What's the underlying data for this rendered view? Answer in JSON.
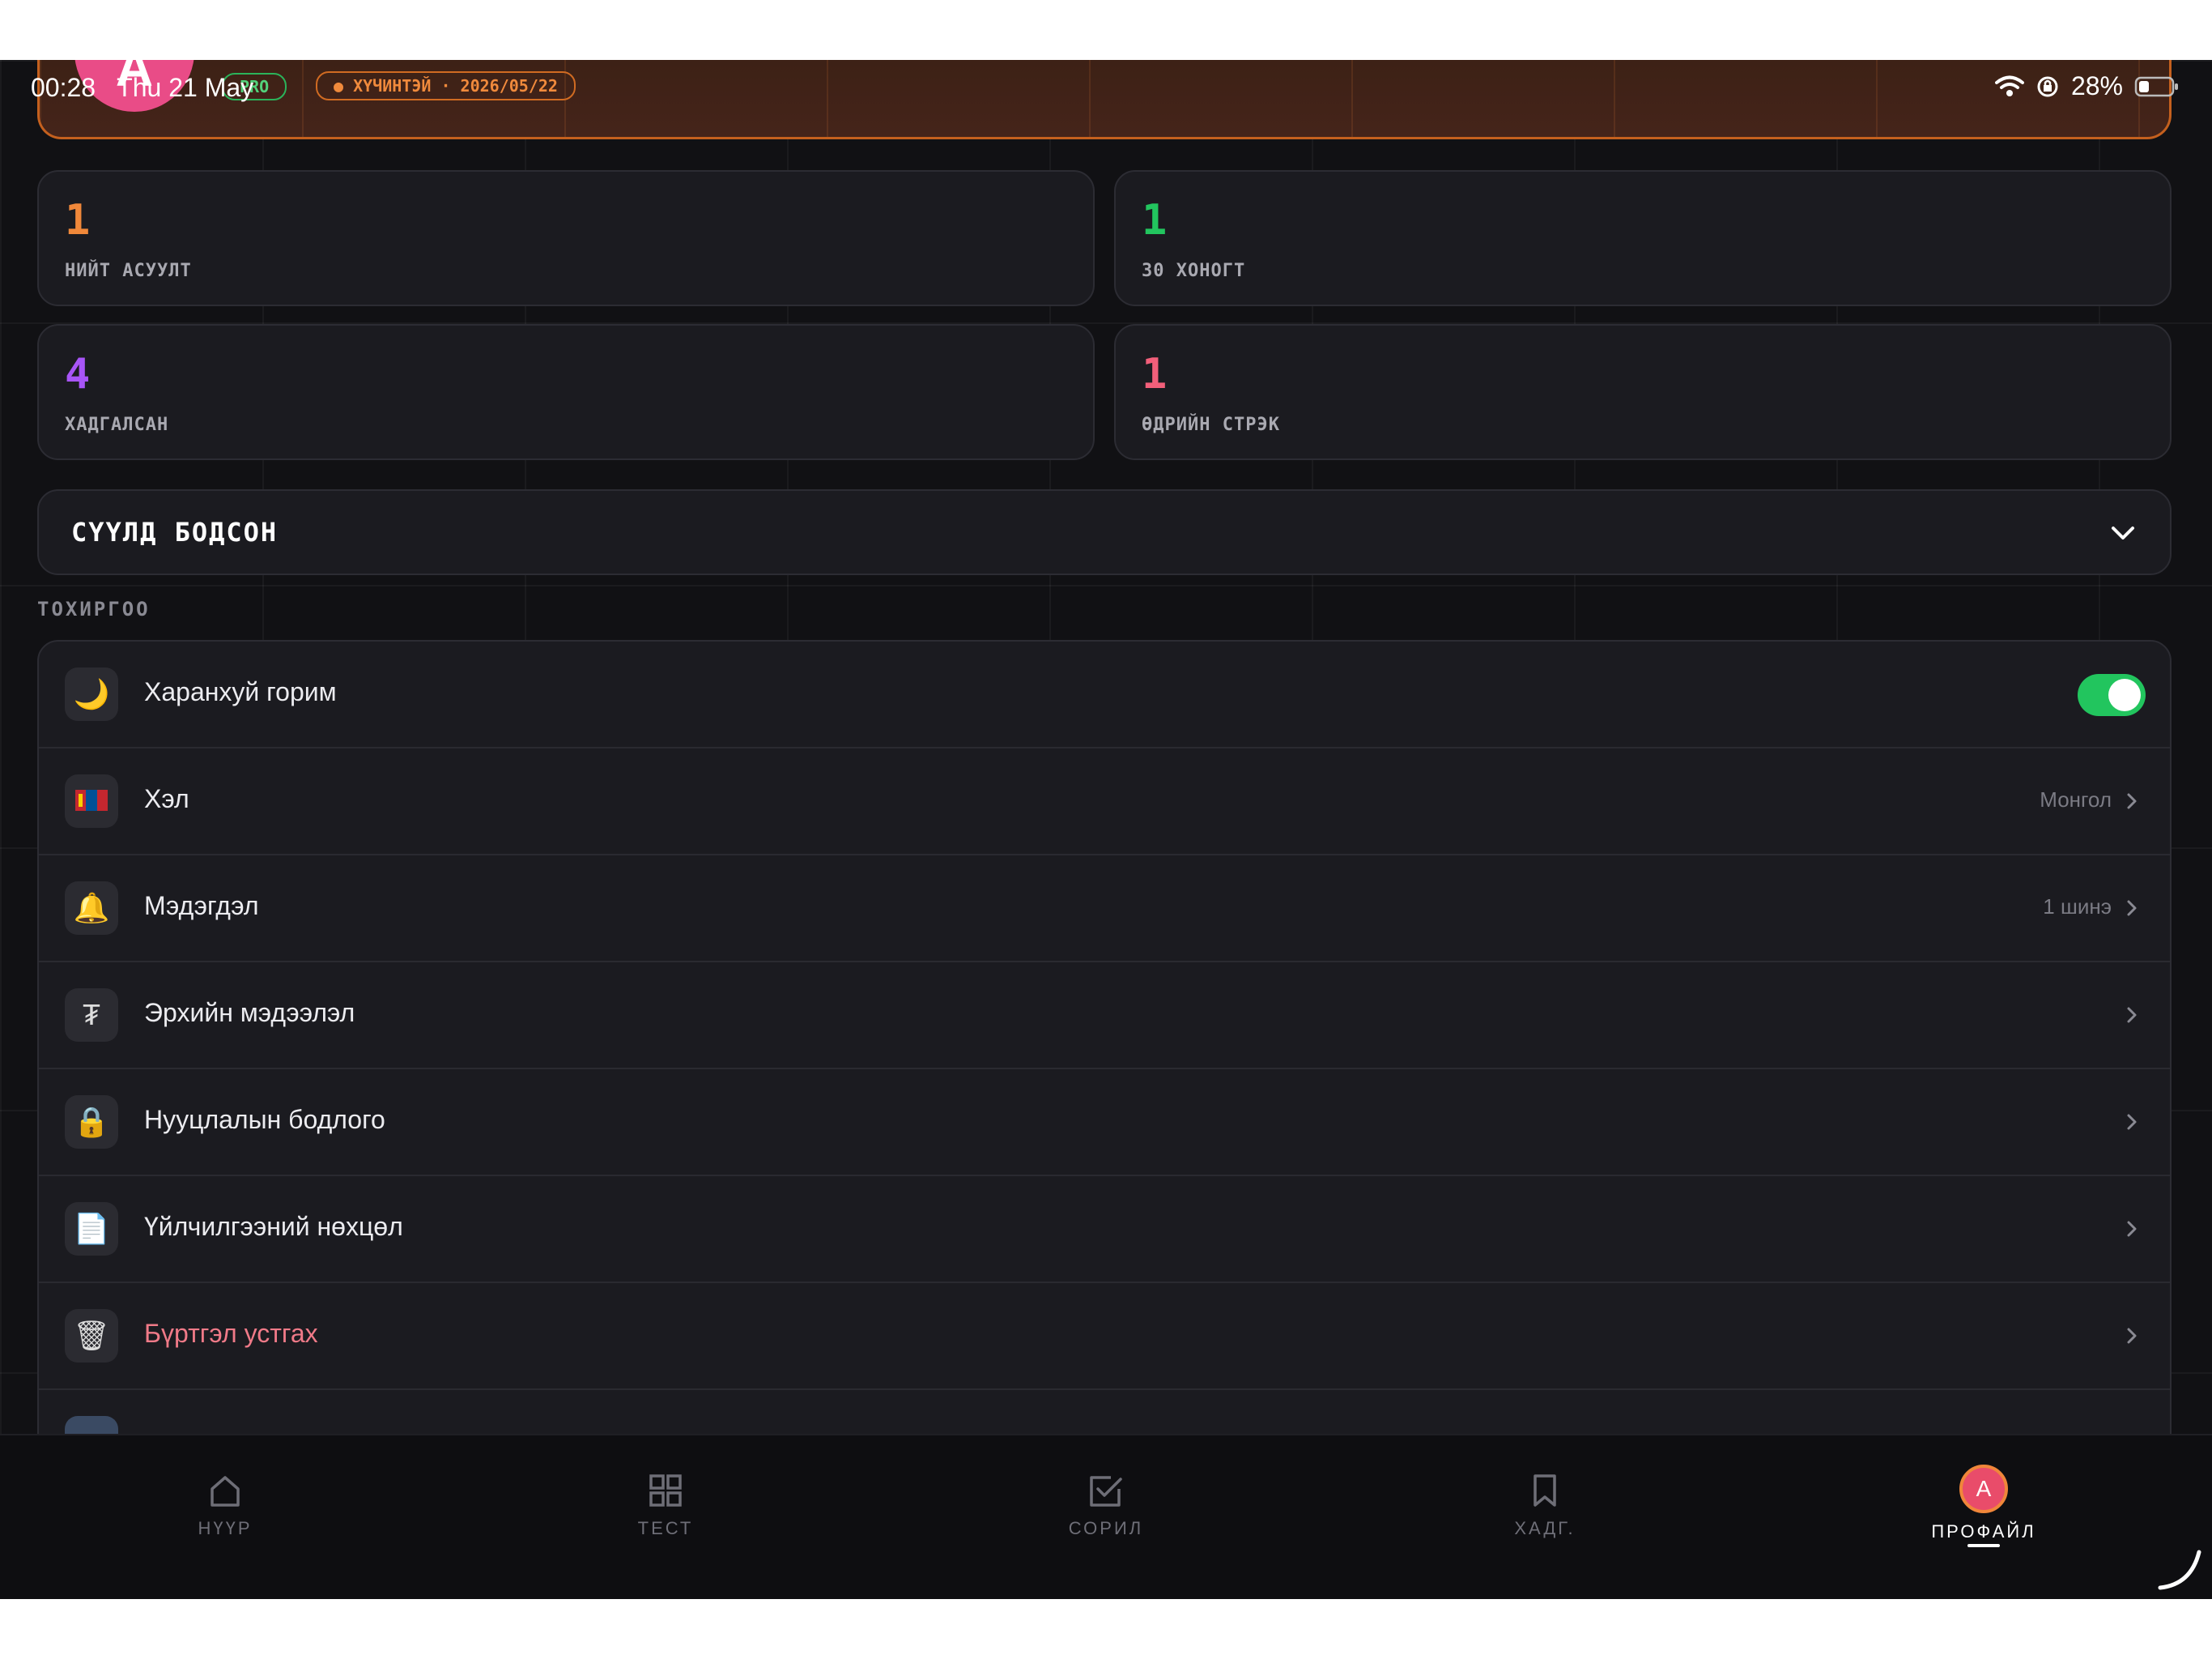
{
  "status_bar": {
    "time": "00:28",
    "date": "Thu 21 May",
    "battery": "28%"
  },
  "profile": {
    "avatar_letter": "A",
    "plan_badge": "PRO",
    "status_badge": "● ХҮЧИНТЭЙ · 2026/05/22"
  },
  "stats": [
    {
      "value": "1",
      "label": "НИЙТ АСУУЛТ",
      "color": "#f0883a"
    },
    {
      "value": "1",
      "label": "30 ХОНОГТ",
      "color": "#22c55e"
    },
    {
      "value": "4",
      "label": "ХАДГАЛСАН",
      "color": "#a855f7"
    },
    {
      "value": "1",
      "label": "ӨДРИЙН СТРЭК",
      "color": "#f25f7a"
    }
  ],
  "recent": {
    "title": "СҮҮЛД БОДСОН"
  },
  "settings": {
    "section_title": "ТОХИРГОО",
    "items": [
      {
        "icon": "moon-icon",
        "glyph": "🌙",
        "label": "Харанхуй горим",
        "toggle_on": true
      },
      {
        "icon": "flag-icon",
        "glyph": "▮",
        "label": "Хэл",
        "value": "Монгол"
      },
      {
        "icon": "bell-icon",
        "glyph": "🔔",
        "label": "Мэдэгдэл",
        "value": "1 шинэ"
      },
      {
        "icon": "tugrik-icon",
        "glyph": "₮",
        "label": "Эрхийн мэдээлэл"
      },
      {
        "icon": "lock-icon",
        "glyph": "🔒",
        "label": "Нууцлалын бодлого"
      },
      {
        "icon": "document-icon",
        "glyph": "📄",
        "label": "Үйлчилгээний нөхцөл"
      },
      {
        "icon": "trash-icon",
        "glyph": "🗑",
        "label": "Бүртгэл устгах",
        "danger": true
      }
    ]
  },
  "tabs": [
    {
      "label": "НҮҮР",
      "icon": "home-icon"
    },
    {
      "label": "ТЕСТ",
      "icon": "grid-icon"
    },
    {
      "label": "СОРИЛ",
      "icon": "checkbox-icon"
    },
    {
      "label": "ХАДГ.",
      "icon": "bookmark-icon"
    },
    {
      "label": "ПРОФАЙЛ",
      "icon": "avatar",
      "active": true
    }
  ]
}
